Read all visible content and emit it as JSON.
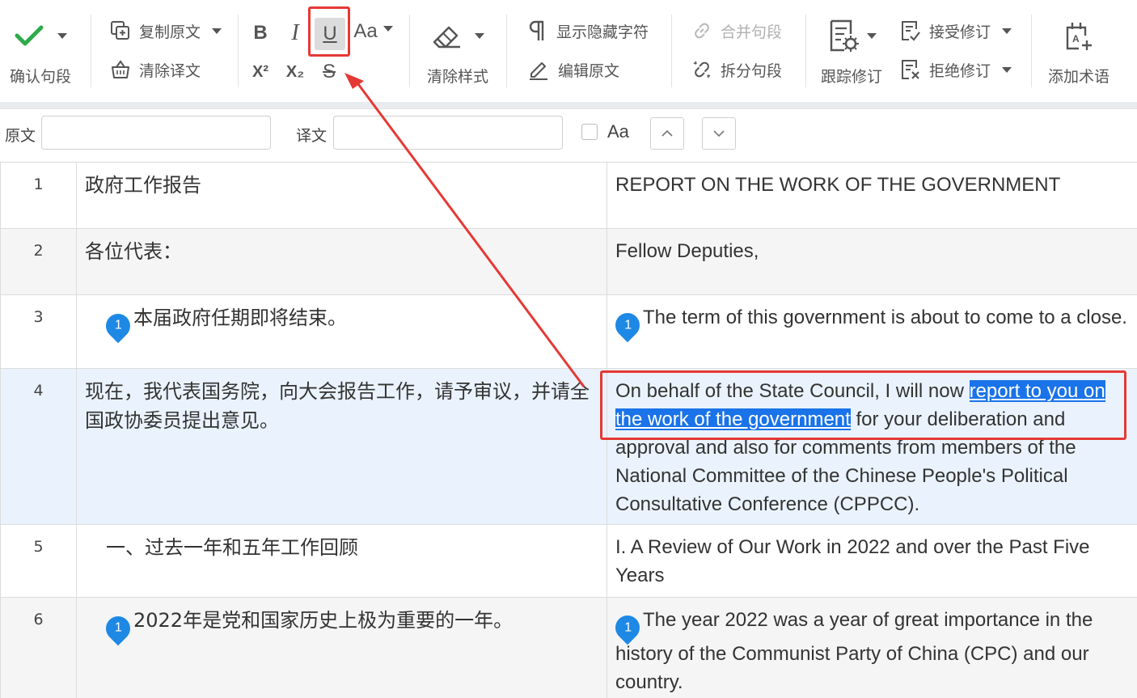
{
  "toolbar": {
    "confirm_label": "确认句段",
    "copy_source_label": "复制原文",
    "clear_target_label": "清除译文",
    "bold": "B",
    "italic": "I",
    "underline": "U",
    "case": "Aa",
    "superscript": "X²",
    "subscript": "X₂",
    "strikethrough": "S",
    "clear_style_label": "清除样式",
    "show_hidden_label": "显示隐藏字符",
    "edit_source_label": "编辑原文",
    "merge_label": "合并句段",
    "split_label": "拆分句段",
    "track_changes_label": "跟踪修订",
    "accept_label": "接受修订",
    "reject_label": "拒绝修订",
    "add_term_label": "添加术语"
  },
  "search": {
    "source_label": "原文",
    "target_label": "译文",
    "case_label": "Aa"
  },
  "rows": [
    {
      "num": "1",
      "source": "政府工作报告",
      "target": "REPORT ON THE WORK OF THE GOVERNMENT"
    },
    {
      "num": "2",
      "source": "各位代表：",
      "target": "Fellow Deputies,"
    },
    {
      "num": "3",
      "badge": "1",
      "source": "本届政府任期即将结束。",
      "target": "The term of this government is about to come to a close."
    },
    {
      "num": "4",
      "source": "现在，我代表国务院，向大会报告工作，请予审议，并请全国政协委员提出意见。",
      "target_before": "On behalf of the State Council, I will now ",
      "target_highlight": "report to you on the work of the government",
      "target_after": " for your deliberation and approval and also for comments from members of the National Committee of the Chinese People's Political Consultative Conference (CPPCC)."
    },
    {
      "num": "5",
      "source": "一、过去一年和五年工作回顾",
      "target": "I. A Review of Our Work in 2022 and over the Past Five Years"
    },
    {
      "num": "6",
      "badge": "1",
      "source": "2022年是党和国家历史上极为重要的一年。",
      "target": "The year 2022 was a year of great importance in the history of the Communist Party of China (CPC) and our country."
    }
  ],
  "colors": {
    "accent": "#1a73e8",
    "confirm": "#2eaa4a",
    "annotation": "#e53935"
  }
}
